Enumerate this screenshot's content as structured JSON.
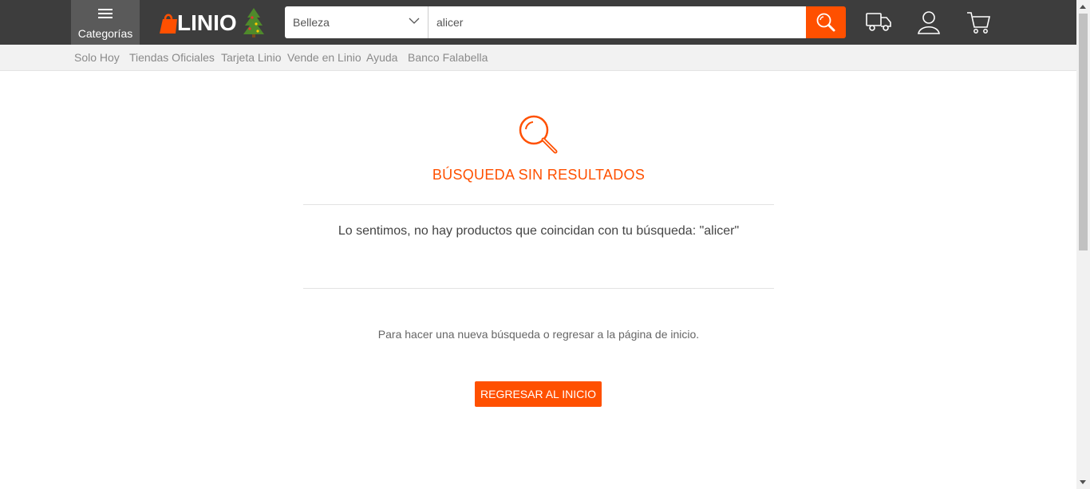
{
  "header": {
    "categories_label": "Categorías",
    "logo_text": "LINIO",
    "search": {
      "category": "Belleza",
      "query": "alicer"
    },
    "accent_color": "#ff5000",
    "icons": [
      "menu-icon",
      "search-icon",
      "truck-icon",
      "user-icon",
      "cart-icon"
    ]
  },
  "subnav": {
    "links": [
      "Solo Hoy",
      "Tiendas Oficiales",
      "Tarjeta Linio",
      "Vende en Linio",
      "Ayuda",
      "Banco Falabella"
    ]
  },
  "main": {
    "title": "BÚSQUEDA SIN RESULTADOS",
    "sorry_text": "Lo sentimos, no hay productos que coincidan con tu búsqueda: \"alicer\"",
    "hint_text": "Para hacer una nueva búsqueda o regresar a la página de inicio.",
    "home_button": "REGRESAR AL INICIO"
  }
}
